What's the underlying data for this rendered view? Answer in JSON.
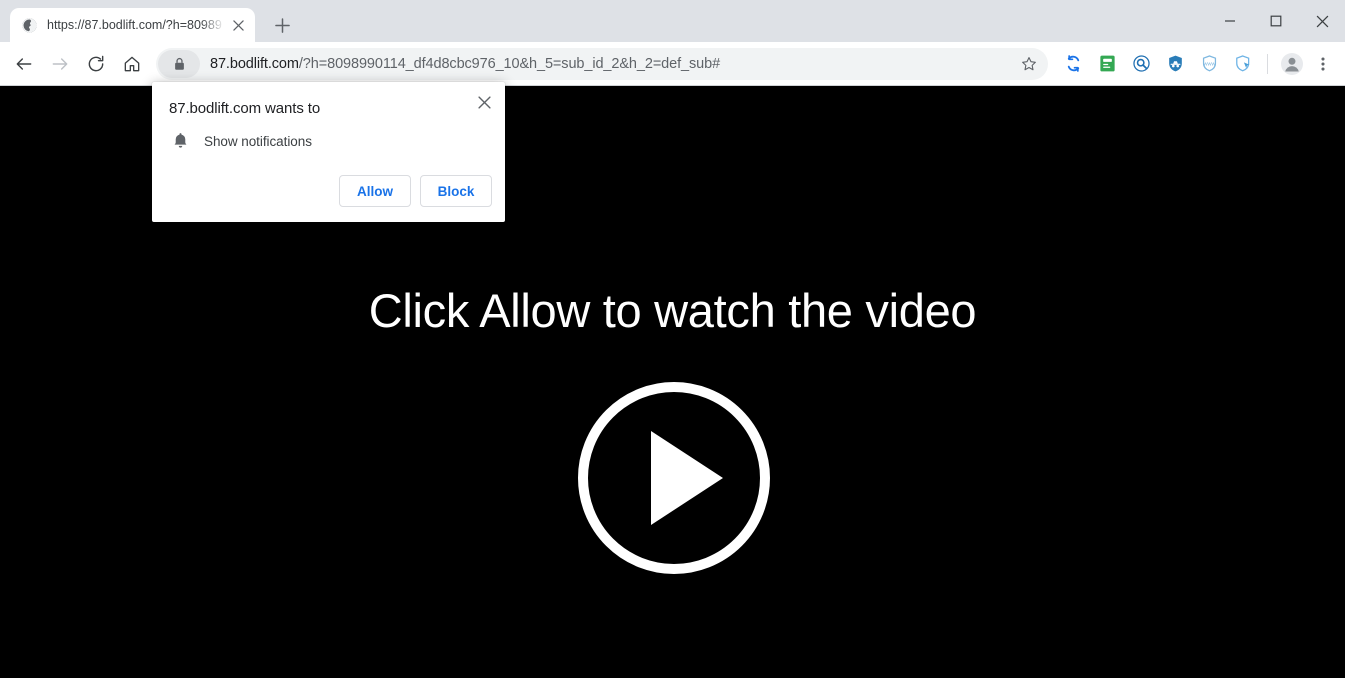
{
  "window": {
    "controls": [
      {
        "name": "minimize",
        "glyph": "minimize-icon"
      },
      {
        "name": "maximize",
        "glyph": "maximize-icon"
      },
      {
        "name": "close",
        "glyph": "close-icon"
      }
    ]
  },
  "tab": {
    "title": "https://87.bodlift.com/?h=80989",
    "favicon": "globe-icon",
    "close_label": "close-tab-icon",
    "newtab_label": "new-tab-icon"
  },
  "toolbar": {
    "back": "back-arrow-icon",
    "forward": "forward-arrow-icon",
    "reload": "reload-icon",
    "home": "home-icon",
    "lock": "lock-icon",
    "url_host": "87.bodlift.com",
    "url_path": "/?h=8098990114_df4d8cbc976_10&h_5=sub_id_2&h_2=def_sub#",
    "star": "bookmark-star-icon",
    "extensions": [
      {
        "name": "sync-extension-icon",
        "color": "#1a73e8"
      },
      {
        "name": "green-document-extension-icon",
        "color": "#34a853"
      },
      {
        "name": "magnifier-extension-icon",
        "color": "#1f6fb2"
      },
      {
        "name": "incognito-hat-shield-extension-icon",
        "color": "#2a7db8"
      },
      {
        "name": "www-shield-extension-icon",
        "color": "#7fb8e0"
      },
      {
        "name": "cursor-shield-extension-icon",
        "color": "#6fb4e6"
      }
    ],
    "profile": "profile-avatar-icon",
    "menu": "three-dot-menu-icon"
  },
  "permission_dialog": {
    "title": "87.bodlift.com wants to",
    "request_icon": "bell-icon",
    "request_label": "Show notifications",
    "allow_label": "Allow",
    "block_label": "Block",
    "close_label": "close-dialog-icon",
    "accent_color": "#1a73e8"
  },
  "page": {
    "background_color": "#000000",
    "headline": "Click Allow to watch the video",
    "play_button": "play-button-icon",
    "play_button_color": "#ffffff"
  }
}
